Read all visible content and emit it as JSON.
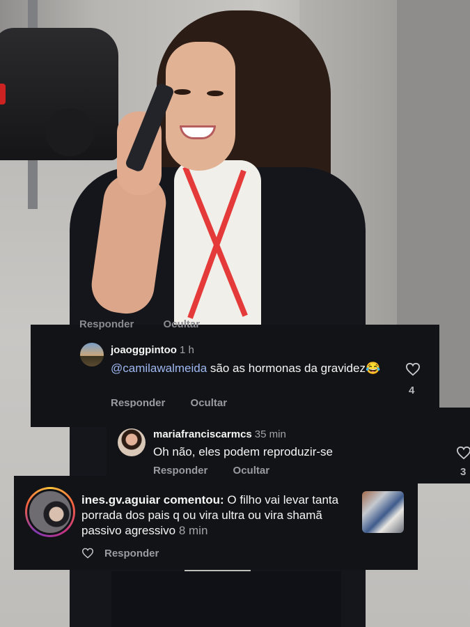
{
  "cut_row": {
    "reply": "Responder",
    "hide": "Ocultar"
  },
  "comment1": {
    "username": "joaoggpintoo",
    "time": "1 h",
    "mention": "@camilawalmeida",
    "text": " são as hormonas da gravidez",
    "emoji": "😂",
    "reply_label": "Responder",
    "hide_label": "Ocultar",
    "like_count": "4"
  },
  "comment2": {
    "username": "mariafranciscarmcs",
    "time": "35 min",
    "text": "Oh não, eles podem reproduzir-se",
    "reply_label": "Responder",
    "hide_label": "Ocultar",
    "like_count": "3"
  },
  "comment3": {
    "username": "ines.gv.aguiar",
    "verb": " comentou: ",
    "text": "O filho vai levar tanta porrada dos pais q ou vira ultra ou vira shamã passivo agressivo ",
    "time": "8 min",
    "reply_label": "Responder"
  },
  "colors": {
    "card_bg": "#121317",
    "mention": "#9fb8f2",
    "muted": "#9a9ba0"
  },
  "icons": [
    "heart-icon",
    "avatar",
    "story-ring"
  ]
}
